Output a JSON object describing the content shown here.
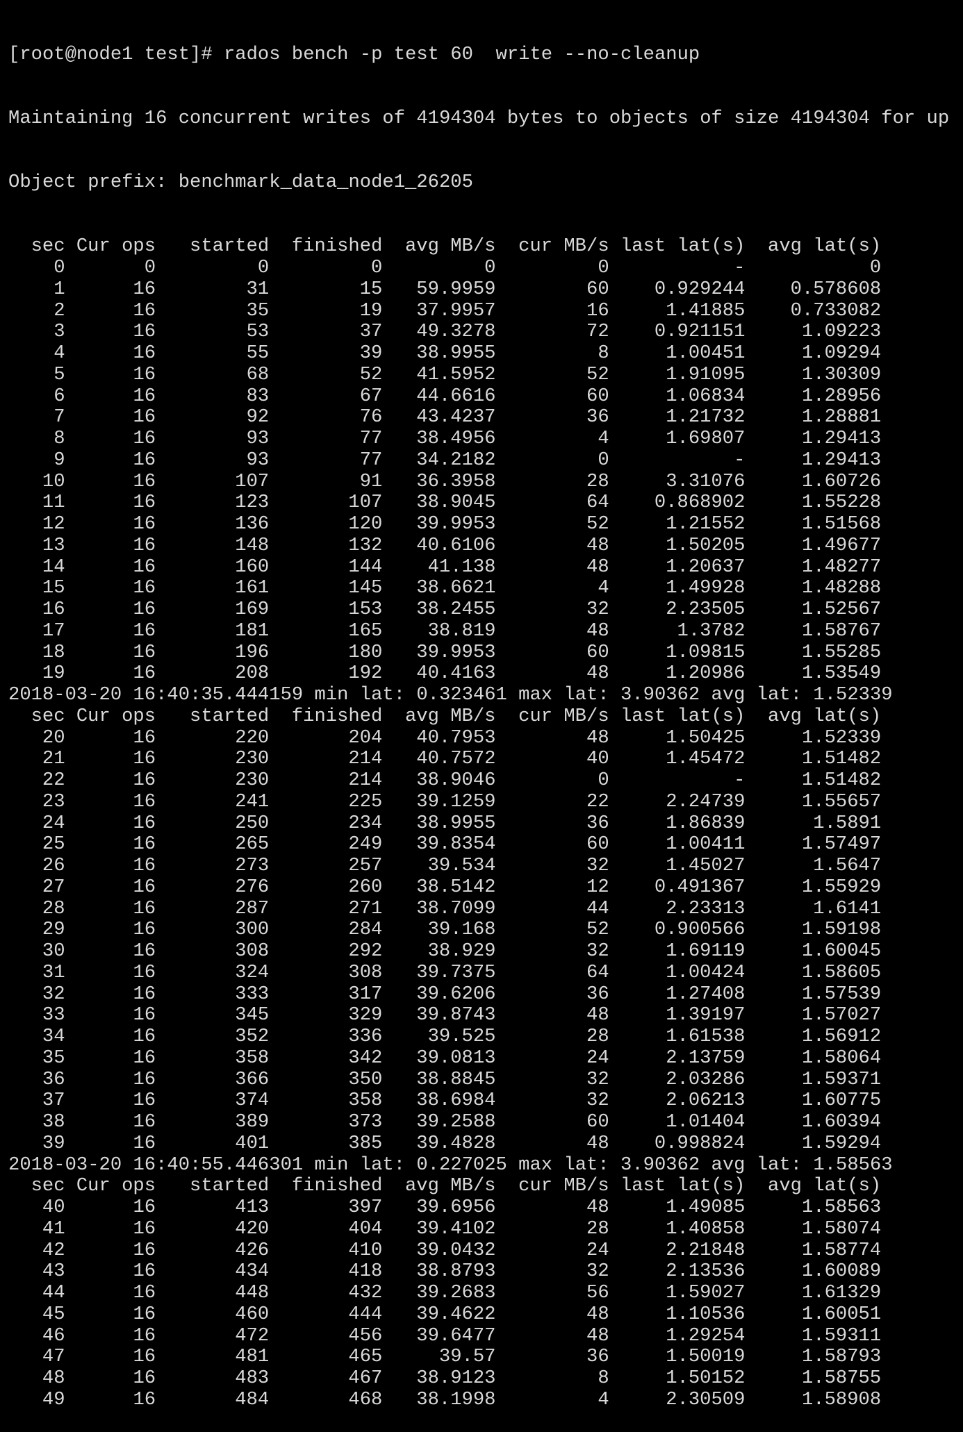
{
  "command": "[root@node1 test]# rados bench -p test 60  write --no-cleanup",
  "intro": [
    "Maintaining 16 concurrent writes of 4194304 bytes to objects of size 4194304 for up",
    "Object prefix: benchmark_data_node1_26205"
  ],
  "columns": [
    "sec",
    "Cur ops",
    "started",
    "finished",
    "avg MB/s",
    "cur MB/s",
    "last lat(s)",
    "avg lat(s)"
  ],
  "blocks": [
    {
      "rows": [
        [
          "0",
          "0",
          "0",
          "0",
          "0",
          "0",
          "-",
          "0"
        ],
        [
          "1",
          "16",
          "31",
          "15",
          "59.9959",
          "60",
          "0.929244",
          "0.578608"
        ],
        [
          "2",
          "16",
          "35",
          "19",
          "37.9957",
          "16",
          "1.41885",
          "0.733082"
        ],
        [
          "3",
          "16",
          "53",
          "37",
          "49.3278",
          "72",
          "0.921151",
          "1.09223"
        ],
        [
          "4",
          "16",
          "55",
          "39",
          "38.9955",
          "8",
          "1.00451",
          "1.09294"
        ],
        [
          "5",
          "16",
          "68",
          "52",
          "41.5952",
          "52",
          "1.91095",
          "1.30309"
        ],
        [
          "6",
          "16",
          "83",
          "67",
          "44.6616",
          "60",
          "1.06834",
          "1.28956"
        ],
        [
          "7",
          "16",
          "92",
          "76",
          "43.4237",
          "36",
          "1.21732",
          "1.28881"
        ],
        [
          "8",
          "16",
          "93",
          "77",
          "38.4956",
          "4",
          "1.69807",
          "1.29413"
        ],
        [
          "9",
          "16",
          "93",
          "77",
          "34.2182",
          "0",
          "-",
          "1.29413"
        ],
        [
          "10",
          "16",
          "107",
          "91",
          "36.3958",
          "28",
          "3.31076",
          "1.60726"
        ],
        [
          "11",
          "16",
          "123",
          "107",
          "38.9045",
          "64",
          "0.868902",
          "1.55228"
        ],
        [
          "12",
          "16",
          "136",
          "120",
          "39.9953",
          "52",
          "1.21552",
          "1.51568"
        ],
        [
          "13",
          "16",
          "148",
          "132",
          "40.6106",
          "48",
          "1.50205",
          "1.49677"
        ],
        [
          "14",
          "16",
          "160",
          "144",
          "41.138",
          "48",
          "1.20637",
          "1.48277"
        ],
        [
          "15",
          "16",
          "161",
          "145",
          "38.6621",
          "4",
          "1.49928",
          "1.48288"
        ],
        [
          "16",
          "16",
          "169",
          "153",
          "38.2455",
          "32",
          "2.23505",
          "1.52567"
        ],
        [
          "17",
          "16",
          "181",
          "165",
          "38.819",
          "48",
          "1.3782",
          "1.58767"
        ],
        [
          "18",
          "16",
          "196",
          "180",
          "39.9953",
          "60",
          "1.09815",
          "1.55285"
        ],
        [
          "19",
          "16",
          "208",
          "192",
          "40.4163",
          "48",
          "1.20986",
          "1.53549"
        ]
      ],
      "summary": "2018-03-20 16:40:35.444159 min lat: 0.323461 max lat: 3.90362 avg lat: 1.52339"
    },
    {
      "rows": [
        [
          "20",
          "16",
          "220",
          "204",
          "40.7953",
          "48",
          "1.50425",
          "1.52339"
        ],
        [
          "21",
          "16",
          "230",
          "214",
          "40.7572",
          "40",
          "1.45472",
          "1.51482"
        ],
        [
          "22",
          "16",
          "230",
          "214",
          "38.9046",
          "0",
          "-",
          "1.51482"
        ],
        [
          "23",
          "16",
          "241",
          "225",
          "39.1259",
          "22",
          "2.24739",
          "1.55657"
        ],
        [
          "24",
          "16",
          "250",
          "234",
          "38.9955",
          "36",
          "1.86839",
          "1.5891"
        ],
        [
          "25",
          "16",
          "265",
          "249",
          "39.8354",
          "60",
          "1.00411",
          "1.57497"
        ],
        [
          "26",
          "16",
          "273",
          "257",
          "39.534",
          "32",
          "1.45027",
          "1.5647"
        ],
        [
          "27",
          "16",
          "276",
          "260",
          "38.5142",
          "12",
          "0.491367",
          "1.55929"
        ],
        [
          "28",
          "16",
          "287",
          "271",
          "38.7099",
          "44",
          "2.23313",
          "1.6141"
        ],
        [
          "29",
          "16",
          "300",
          "284",
          "39.168",
          "52",
          "0.900566",
          "1.59198"
        ],
        [
          "30",
          "16",
          "308",
          "292",
          "38.929",
          "32",
          "1.69119",
          "1.60045"
        ],
        [
          "31",
          "16",
          "324",
          "308",
          "39.7375",
          "64",
          "1.00424",
          "1.58605"
        ],
        [
          "32",
          "16",
          "333",
          "317",
          "39.6206",
          "36",
          "1.27408",
          "1.57539"
        ],
        [
          "33",
          "16",
          "345",
          "329",
          "39.8743",
          "48",
          "1.39197",
          "1.57027"
        ],
        [
          "34",
          "16",
          "352",
          "336",
          "39.525",
          "28",
          "1.61538",
          "1.56912"
        ],
        [
          "35",
          "16",
          "358",
          "342",
          "39.0813",
          "24",
          "2.13759",
          "1.58064"
        ],
        [
          "36",
          "16",
          "366",
          "350",
          "38.8845",
          "32",
          "2.03286",
          "1.59371"
        ],
        [
          "37",
          "16",
          "374",
          "358",
          "38.6984",
          "32",
          "2.06213",
          "1.60775"
        ],
        [
          "38",
          "16",
          "389",
          "373",
          "39.2588",
          "60",
          "1.01404",
          "1.60394"
        ],
        [
          "39",
          "16",
          "401",
          "385",
          "39.4828",
          "48",
          "0.998824",
          "1.59294"
        ]
      ],
      "summary": "2018-03-20 16:40:55.446301 min lat: 0.227025 max lat: 3.90362 avg lat: 1.58563"
    },
    {
      "rows": [
        [
          "40",
          "16",
          "413",
          "397",
          "39.6956",
          "48",
          "1.49085",
          "1.58563"
        ],
        [
          "41",
          "16",
          "420",
          "404",
          "39.4102",
          "28",
          "1.40858",
          "1.58074"
        ],
        [
          "42",
          "16",
          "426",
          "410",
          "39.0432",
          "24",
          "2.21848",
          "1.58774"
        ],
        [
          "43",
          "16",
          "434",
          "418",
          "38.8793",
          "32",
          "2.13536",
          "1.60089"
        ],
        [
          "44",
          "16",
          "448",
          "432",
          "39.2683",
          "56",
          "1.59027",
          "1.61329"
        ],
        [
          "45",
          "16",
          "460",
          "444",
          "39.4622",
          "48",
          "1.10536",
          "1.60051"
        ],
        [
          "46",
          "16",
          "472",
          "456",
          "39.6477",
          "48",
          "1.29254",
          "1.59311"
        ],
        [
          "47",
          "16",
          "481",
          "465",
          "39.57",
          "36",
          "1.50019",
          "1.58793"
        ],
        [
          "48",
          "16",
          "483",
          "467",
          "38.9123",
          "8",
          "1.50152",
          "1.58755"
        ],
        [
          "49",
          "16",
          "484",
          "468",
          "38.1998",
          "4",
          "2.30509",
          "1.58908"
        ]
      ],
      "summary": null
    }
  ]
}
